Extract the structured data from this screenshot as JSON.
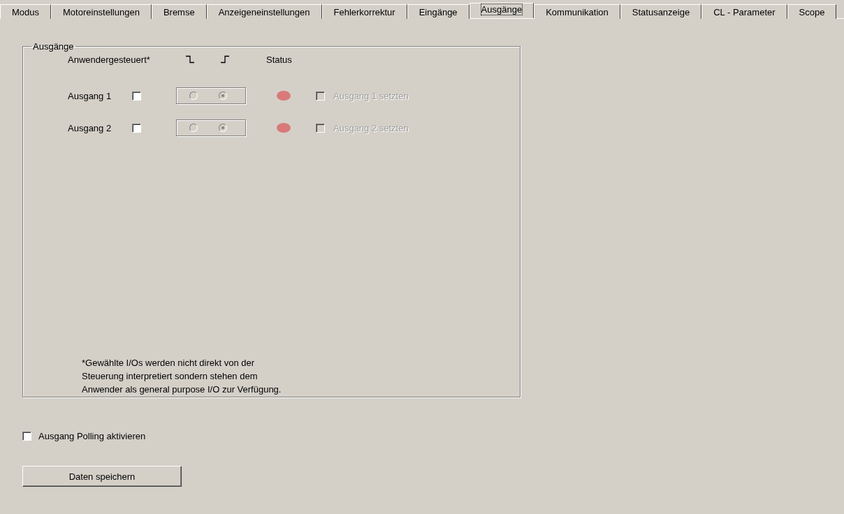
{
  "tabs": [
    {
      "label": "Modus",
      "selected": false
    },
    {
      "label": "Motoreinstellungen",
      "selected": false
    },
    {
      "label": "Bremse",
      "selected": false
    },
    {
      "label": "Anzeigeneinstellungen",
      "selected": false
    },
    {
      "label": "Fehlerkorrektur",
      "selected": false
    },
    {
      "label": "Eingänge",
      "selected": false
    },
    {
      "label": "Ausgänge",
      "selected": true
    },
    {
      "label": "Kommunikation",
      "selected": false
    },
    {
      "label": "Statusanzeige",
      "selected": false
    },
    {
      "label": "CL - Parameter",
      "selected": false
    },
    {
      "label": "Scope",
      "selected": false
    }
  ],
  "group": {
    "title": "Ausgänge",
    "header": {
      "user_controlled": "Anwendergesteuert*",
      "status": "Status"
    },
    "outputs": [
      {
        "label": "Ausgang 1",
        "checked": false,
        "falling_selected": false,
        "rising_selected": true,
        "color": "#d87a7a",
        "set_label": "Ausgang 1 setzten",
        "set_checked": false,
        "set_disabled": true
      },
      {
        "label": "Ausgang 2",
        "checked": false,
        "falling_selected": false,
        "rising_selected": true,
        "color": "#d87a7a",
        "set_label": "Ausgang 2 setzten",
        "set_checked": false,
        "set_disabled": true
      }
    ],
    "note": [
      "*Gewählte I/Os werden nicht direkt von der",
      "Steuerung interpretiert sondern stehen dem",
      "Anwender als general purpose I/O zur Verfügung."
    ]
  },
  "polling": {
    "label": "Ausgang Polling aktivieren",
    "checked": false
  },
  "save_button": "Daten speichern"
}
